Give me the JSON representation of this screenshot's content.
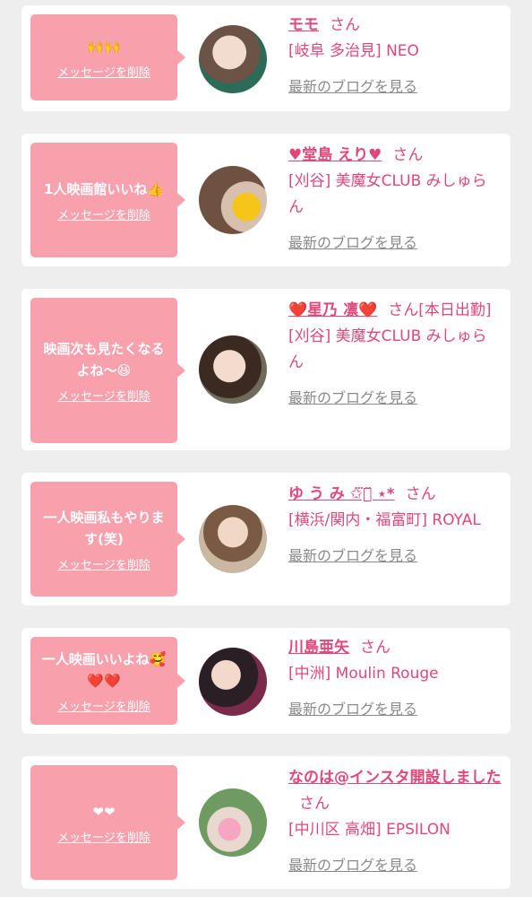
{
  "common": {
    "delete_label": "メッセージを削除",
    "san_label": "さん",
    "blog_link_label": "最新のブログを見る"
  },
  "messages": [
    {
      "message": "🙌🙌",
      "girl_name": "モモ",
      "status": "",
      "shop": "[岐阜 多治見] NEO",
      "avatar_color": "#c9b3a8"
    },
    {
      "message": "1人映画館いいね👍",
      "girl_name": "♥堂島 えり♥",
      "status": "",
      "shop": "[刈谷] 美魔女CLUB みしゅらん",
      "avatar_color": "#8a6a52"
    },
    {
      "message": "映画次も見たくなるよね〜😆",
      "girl_name": "❤️星乃 凛❤️",
      "status": "[本日出勤]",
      "shop": "[刈谷] 美魔女CLUB みしゅらん",
      "avatar_color": "#b99b8d"
    },
    {
      "message": "一人映画私もやります(笑)",
      "girl_name": "ゆ う み ✩⃛⌔̈ ⋆*",
      "status": "",
      "shop": "[横浜/関内・福富町] ROYAL",
      "avatar_color": "#9c7f6c"
    },
    {
      "message": "一人映画いいよね🥰❤️❤️",
      "girl_name": "川島亜矢",
      "status": "",
      "shop": "[中洲] Moulin Rouge",
      "avatar_color": "#4b3a45"
    },
    {
      "message": "❤❤",
      "girl_name": "なのは@インスタ開設しました",
      "status": "",
      "shop": "[中川区 高畑] EPSILON",
      "avatar_color": "#8faf7a"
    }
  ],
  "colors": {
    "bubble": "#f8a1ad",
    "accent": "#e0487a",
    "link_gray": "#8a8a8a",
    "background": "#eeeeee"
  }
}
